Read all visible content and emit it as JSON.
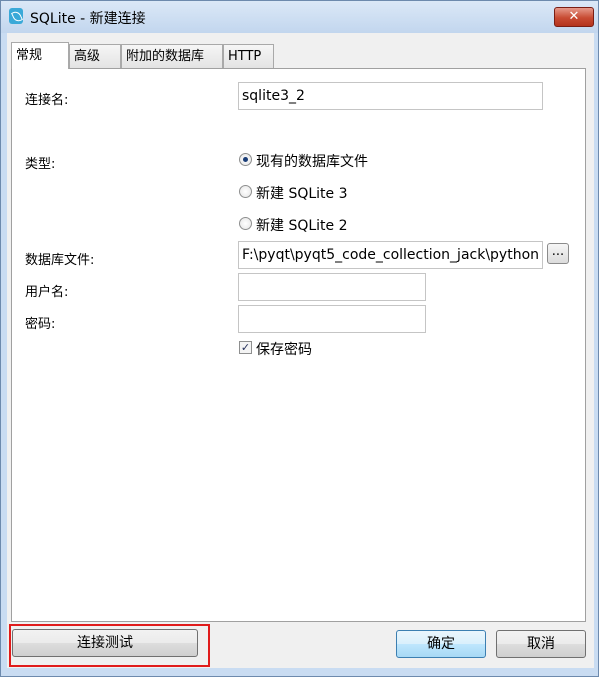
{
  "window": {
    "title": "SQLite - 新建连接",
    "close_label": "✕"
  },
  "tabs": [
    {
      "label": "常规",
      "active": true
    },
    {
      "label": "高级",
      "active": false
    },
    {
      "label": "附加的数据库",
      "active": false
    },
    {
      "label": "HTTP",
      "active": false
    }
  ],
  "form": {
    "connection_name_label": "连接名:",
    "connection_name_value": "sqlite3_2",
    "type_label": "类型:",
    "type_options": [
      {
        "label": "现有的数据库文件",
        "selected": true
      },
      {
        "label": "新建 SQLite 3",
        "selected": false
      },
      {
        "label": "新建 SQLite 2",
        "selected": false
      }
    ],
    "db_file_label": "数据库文件:",
    "db_file_value": "F:\\pyqt\\pyqt5_code_collection_jack\\python",
    "browse_label": "...",
    "username_label": "用户名:",
    "username_value": "",
    "password_label": "密码:",
    "password_value": "",
    "save_password_label": "保存密码",
    "save_password_checked": true
  },
  "buttons": {
    "test": "连接测试",
    "ok": "确定",
    "cancel": "取消"
  },
  "colors": {
    "highlight": "#e01b1b",
    "selection": "#1a3d77"
  }
}
